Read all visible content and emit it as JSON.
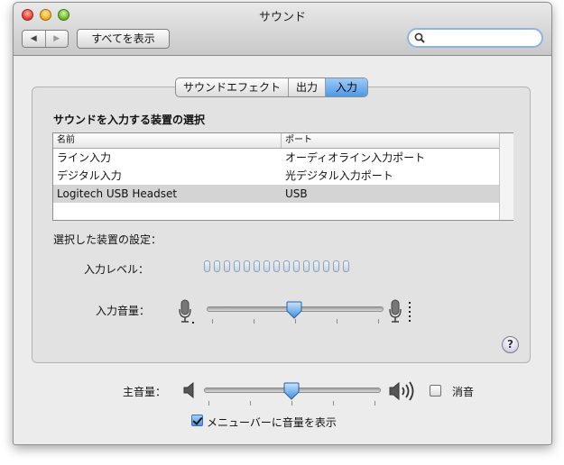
{
  "window": {
    "title": "サウンド"
  },
  "toolbar": {
    "back_glyph": "◀",
    "forward_glyph": "▶",
    "show_all_label": "すべてを表示",
    "search_placeholder": ""
  },
  "tabs": [
    {
      "label": "サウンドエフェクト",
      "active": false
    },
    {
      "label": "出力",
      "active": false
    },
    {
      "label": "入力",
      "active": true
    }
  ],
  "input": {
    "section_title": "サウンドを入力する装置の選択",
    "columns": [
      "名前",
      "ポート"
    ],
    "devices": [
      {
        "name": "ライン入力",
        "port": "オーディオライン入力ポート",
        "selected": false
      },
      {
        "name": "デジタル入力",
        "port": "光デジタル入力ポート",
        "selected": false
      },
      {
        "name": "Logitech USB Headset",
        "port": "USB",
        "selected": true
      }
    ],
    "settings_label": "選択した装置の設定：",
    "level_label": "入力レベル：",
    "level_segments": 15,
    "level_active": 0,
    "volume_label": "入力音量：",
    "volume": 0.5
  },
  "output": {
    "main_volume_label": "主音量：",
    "main_volume": 0.5,
    "mute_label": "消音",
    "mute_checked": false,
    "show_in_menubar_label": "メニューバーに音量を表示",
    "show_in_menubar_checked": true
  },
  "help": {
    "label": "?"
  },
  "icons": {
    "close": "close-icon",
    "minimize": "minimize-icon",
    "zoom": "zoom-icon",
    "search": "magnifier-icon",
    "mic_low": "microphone-low-icon",
    "mic_high": "microphone-high-icon",
    "speaker_low": "speaker-low-icon",
    "speaker_high": "speaker-high-icon"
  }
}
